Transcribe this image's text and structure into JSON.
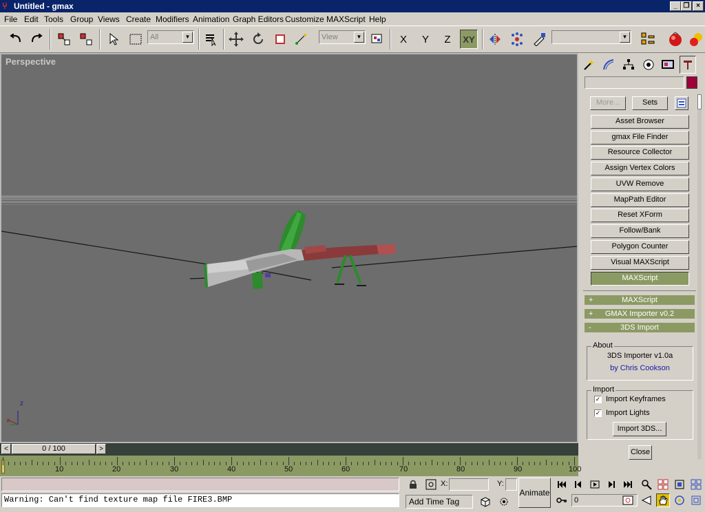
{
  "window": {
    "title": "Untitled - gmax",
    "minimize": "_",
    "restore": "❐",
    "close": "×"
  },
  "menu": [
    "File",
    "Edit",
    "Tools",
    "Group",
    "Views",
    "Create",
    "Modifiers",
    "Animation",
    "Graph Editors",
    "Customize",
    "MAXScript",
    "Help"
  ],
  "toolbar": {
    "selection_filter": "All",
    "ref_coord": "View",
    "axis_x": "X",
    "axis_y": "Y",
    "axis_z": "Z",
    "axis_xy": "XY",
    "named_selection": ""
  },
  "viewport": {
    "label": "Perspective",
    "axis_z": "z",
    "axis_x": "x"
  },
  "panel": {
    "name_field": "",
    "object_color": "#a0003a",
    "more_label": "More...",
    "sets_label": "Sets",
    "utilities": [
      "Asset Browser",
      "gmax File Finder",
      "Resource Collector",
      "Assign Vertex Colors",
      "UVW Remove",
      "MapPath Editor",
      "Reset XForm",
      "Follow/Bank",
      "Polygon Counter",
      "Visual MAXScript",
      "MAXScript"
    ],
    "rollouts": [
      {
        "sign": "+",
        "label": "MAXScript"
      },
      {
        "sign": "+",
        "label": "GMAX Importer v0.2"
      },
      {
        "sign": "-",
        "label": "3DS Import"
      }
    ],
    "about": {
      "title": "About",
      "line1": "3DS Importer v1.0a",
      "line2": "by Chris Cookson"
    },
    "import": {
      "title": "Import",
      "keyframes": "Import Keyframes",
      "keyframes_checked": true,
      "lights": "Import Lights",
      "lights_checked": true,
      "button": "Import 3DS..."
    },
    "close_label": "Close"
  },
  "timeline": {
    "slider": "0 / 100",
    "prev": "<",
    "next": ">",
    "ticks": [
      "10",
      "20",
      "30",
      "40",
      "50",
      "60",
      "70",
      "80",
      "90",
      "100"
    ]
  },
  "status": {
    "prompt": "",
    "warning": "Warning: Can't find texture map file FIRE3.BMP",
    "x_label": "X:",
    "y_label": "Y:",
    "add_time_tag": "Add Time Tag",
    "animate": "Animate",
    "frame": "0"
  },
  "colors": {
    "accent": "#8b9a63",
    "title": "#0a246a",
    "viewport": "#6d6d6d"
  }
}
